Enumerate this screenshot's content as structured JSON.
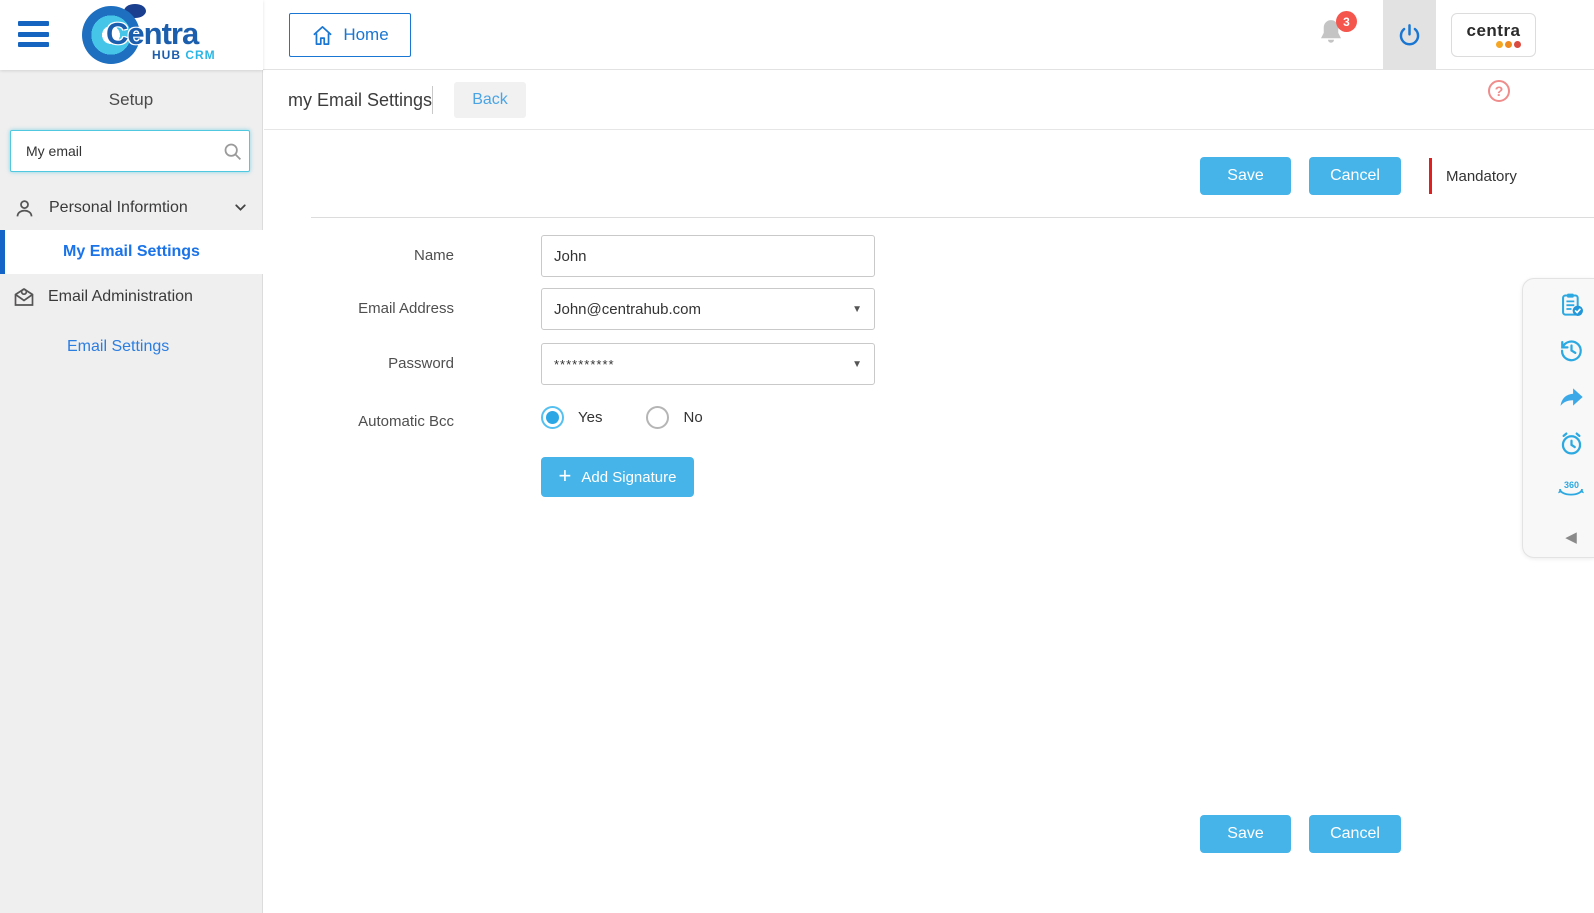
{
  "header": {
    "logo": {
      "brand": "Centra",
      "sub_hub": "HUB",
      "sub_crm": "CRM"
    },
    "home_label": "Home",
    "notification_count": "3",
    "account_logo_text": "centra"
  },
  "sidebar": {
    "title": "Setup",
    "search_value": "My email",
    "items": [
      {
        "label": "Personal Informtion"
      },
      {
        "label": "My Email Settings"
      },
      {
        "label": "Email Administration"
      },
      {
        "label": "Email Settings"
      }
    ]
  },
  "page": {
    "title": "my Email Settings",
    "back_label": "Back",
    "save_label": "Save",
    "cancel_label": "Cancel",
    "mandatory_label": "Mandatory"
  },
  "form": {
    "name_label": "Name",
    "name_value": "John",
    "email_label": "Email Address",
    "email_value": "John@centrahub.com",
    "password_label": "Password",
    "password_value": "**********",
    "bcc_label": "Automatic Bcc",
    "bcc_yes_label": "Yes",
    "bcc_no_label": "No",
    "bcc_selected": "Yes",
    "add_signature_label": "Add Signature"
  },
  "side_toolbar": {
    "icons": [
      "notes-check-icon",
      "history-icon",
      "share-icon",
      "alarm-icon",
      "view-360-icon",
      "collapse-icon"
    ],
    "view_360_text": "360"
  },
  "colors": {
    "accent_blue": "#1976d2",
    "button_blue": "#47b4e9",
    "active_link_blue": "#1a73e8",
    "sidebar_active_bar": "#1464c8",
    "mandatory_red": "#e02020",
    "badge_red": "#f4564e",
    "search_border_cyan": "#4fc8e0"
  }
}
